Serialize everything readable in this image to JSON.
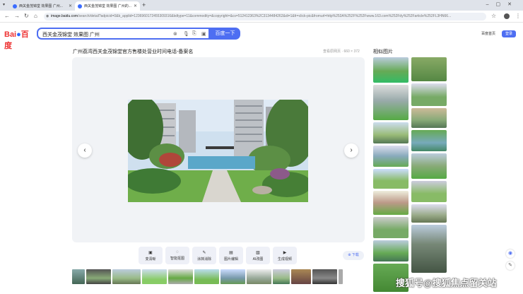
{
  "browser": {
    "tabs": [
      {
        "title": "西关金茂锦堂 效果图 广州..."
      },
      {
        "title": "西关金茂锦堂 效果图 广州的..."
      }
    ],
    "url_host": "image.baidu.com",
    "url_rest": "/search/detail?adpicid=0&b_applid=1236960172455309316&bdtype=11&commodity=&copyright=&cs=512412363%2C3134484262&di=1&fr=click-pic&fromurl=http%253A%252F%252Fwww.163.com%252Fdy%252Farticle%252FL3HN66..."
  },
  "header": {
    "logo_text": "Bai",
    "logo_cn": "百度",
    "search_value": "西关金茂锦堂 效果图 广州",
    "search_button": "百度一下",
    "home_link": "百度首页",
    "login": "登录"
  },
  "main": {
    "title": "广州荔湾西关金茂锦堂官方售楼处营业时间电话-备案名",
    "source": "查看原网页 · 660 × 372",
    "tools": [
      {
        "icon": "hd-icon",
        "glyph": "▣",
        "label": "变清晰"
      },
      {
        "icon": "cutout-icon",
        "glyph": "◌",
        "label": "智能抠图"
      },
      {
        "icon": "eraser-icon",
        "glyph": "✎",
        "label": "涂抹消除"
      },
      {
        "icon": "edit-icon",
        "glyph": "▤",
        "label": "图片编辑"
      },
      {
        "icon": "ai-image-icon",
        "glyph": "▧",
        "label": "AI改图"
      },
      {
        "icon": "video-icon",
        "glyph": "▶",
        "label": "生成视频"
      }
    ],
    "download": "下载",
    "prev": "‹",
    "next": "›"
  },
  "related": {
    "title": "相似图片"
  },
  "watermark": "搜狐号@搜狐焦点留关站",
  "colors": {
    "brand_blue": "#4e6ef2",
    "baidu_red": "#e33"
  }
}
